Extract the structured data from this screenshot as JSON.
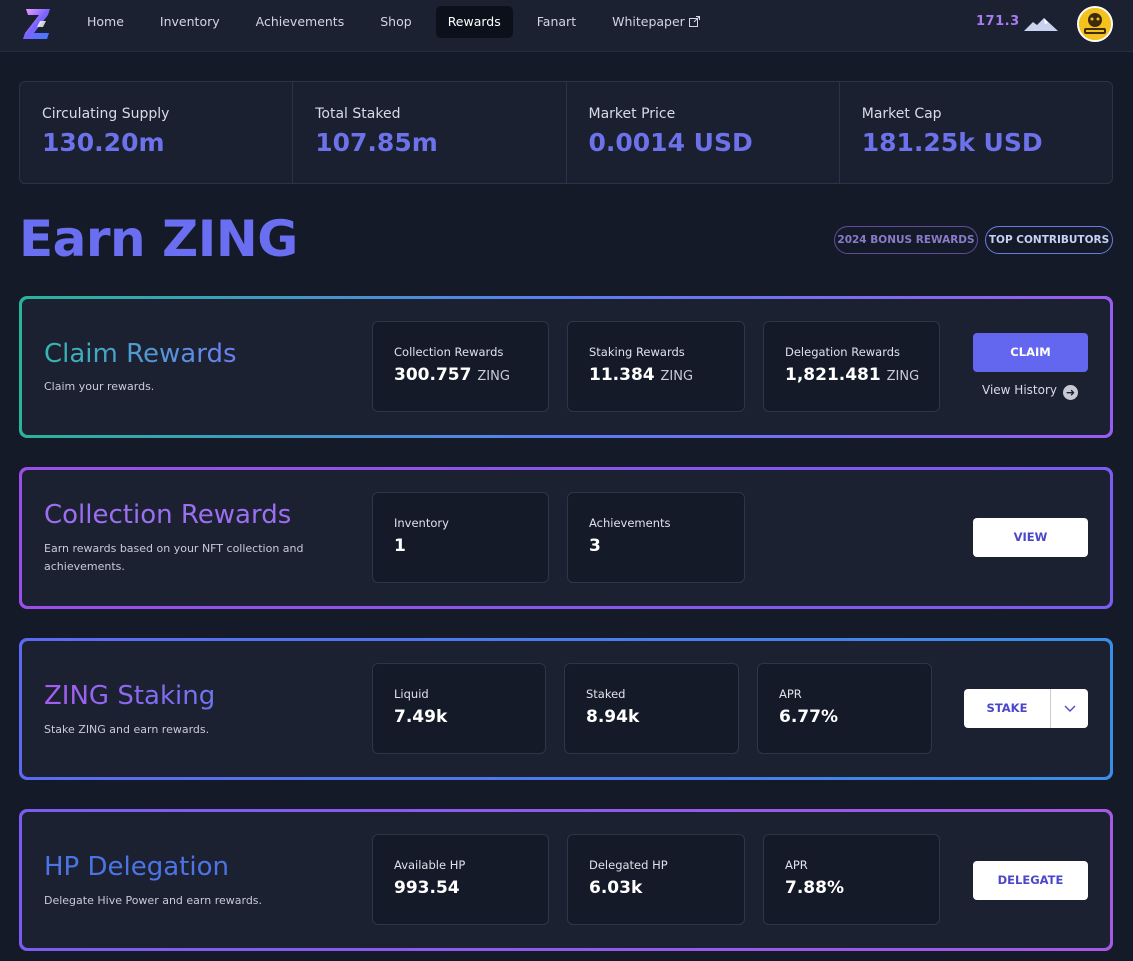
{
  "nav": {
    "items": [
      {
        "label": "Home"
      },
      {
        "label": "Inventory"
      },
      {
        "label": "Achievements"
      },
      {
        "label": "Shop"
      },
      {
        "label": "Rewards",
        "active": true
      },
      {
        "label": "Fanart"
      },
      {
        "label": "Whitepaper",
        "external": true
      }
    ],
    "balance": "171.3",
    "logo_icon": "zing-logo-icon",
    "balance_icon": "hive-mountain-icon",
    "avatar_icon": "user-avatar-icon"
  },
  "stats": [
    {
      "label": "Circulating Supply",
      "value": "130.20m"
    },
    {
      "label": "Total Staked",
      "value": "107.85m"
    },
    {
      "label": "Market Price",
      "value": "0.0014 USD"
    },
    {
      "label": "Market Cap",
      "value": "181.25k USD"
    }
  ],
  "page": {
    "title": "Earn ZING",
    "bonus_label": "2024 BONUS REWARDS",
    "contributors_label": "TOP CONTRIBUTORS"
  },
  "claim": {
    "title": "Claim Rewards",
    "subtitle": "Claim your rewards.",
    "boxes": [
      {
        "label": "Collection Rewards",
        "value": "300.757",
        "unit": "ZING"
      },
      {
        "label": "Staking Rewards",
        "value": "11.384",
        "unit": "ZING"
      },
      {
        "label": "Delegation Rewards",
        "value": "1,821.481",
        "unit": "ZING"
      }
    ],
    "button": "CLAIM",
    "history_link": "View History"
  },
  "collection": {
    "title": "Collection Rewards",
    "subtitle": "Earn rewards based on your NFT collection and achievements.",
    "boxes": [
      {
        "label": "Inventory",
        "value": "1"
      },
      {
        "label": "Achievements",
        "value": "3"
      }
    ],
    "button": "VIEW"
  },
  "staking": {
    "title": "ZING Staking",
    "subtitle": "Stake ZING and earn rewards.",
    "boxes": [
      {
        "label": "Liquid",
        "value": "7.49k"
      },
      {
        "label": "Staked",
        "value": "8.94k"
      },
      {
        "label": "APR",
        "value": "6.77%"
      }
    ],
    "button": "STAKE"
  },
  "delegation": {
    "title": "HP Delegation",
    "subtitle": "Delegate Hive Power and earn rewards.",
    "boxes": [
      {
        "label": "Available HP",
        "value": "993.54"
      },
      {
        "label": "Delegated HP",
        "value": "6.03k"
      },
      {
        "label": "APR",
        "value": "7.88%"
      }
    ],
    "button": "DELEGATE"
  },
  "colors": {
    "accent": "#6366ef",
    "background": "#151a28",
    "balance": "#a77cf2"
  }
}
